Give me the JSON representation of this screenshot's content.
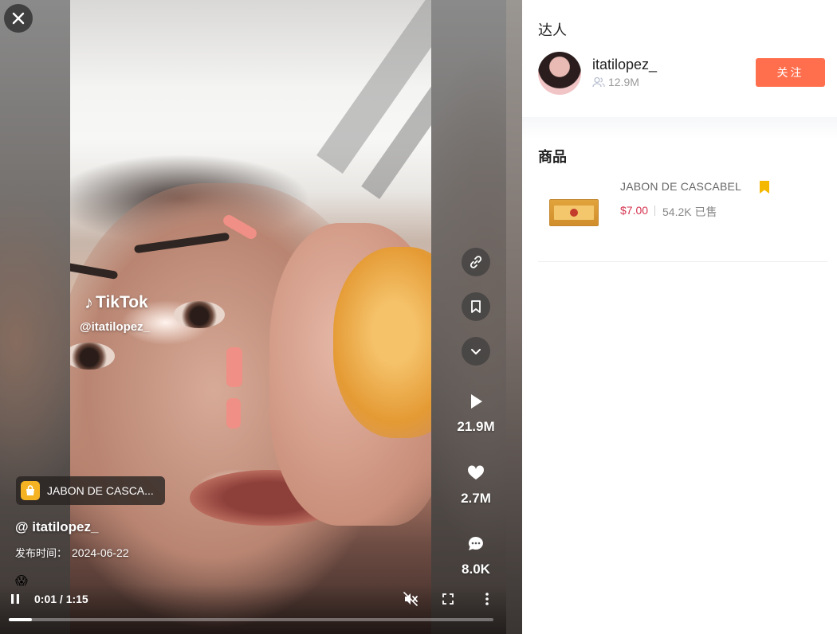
{
  "video": {
    "watermark_brand": "TikTok",
    "watermark_handle": "@itatilopez_",
    "product_chip_label": "JABON DE CASCA...",
    "author_handle": "@ itatilopez_",
    "publish_label": "发布时间：",
    "publish_date": "2024-06-22",
    "caption_emoji": "😱",
    "stats": {
      "plays": "21.9M",
      "likes": "2.7M",
      "comments": "8.0K"
    },
    "player": {
      "time_display": "0:01 / 1:15",
      "progress_fraction": 0.047
    }
  },
  "sidebar": {
    "kol_section_title": "达人",
    "creator": {
      "username": "itatilopez_",
      "followers": "12.9M",
      "follow_label": "关注"
    },
    "products_section_title": "商品",
    "products": [
      {
        "name": "JABON DE CASCABEL",
        "price": "$7.00",
        "sold": "54.2K 已售"
      }
    ]
  },
  "colors": {
    "follow_button": "#ff6f4e",
    "price": "#d4334f",
    "bookmark": "#f5b800",
    "product_chip_icon": "#f5b324"
  }
}
